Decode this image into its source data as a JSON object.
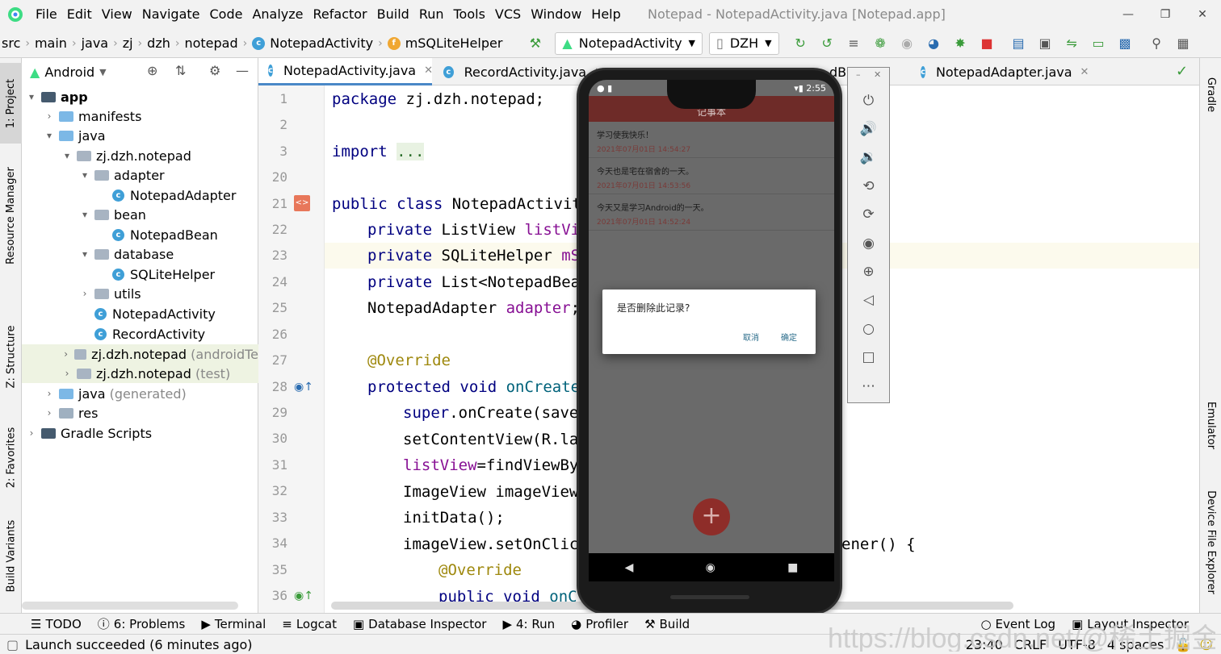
{
  "menubar": {
    "items": [
      "File",
      "Edit",
      "View",
      "Navigate",
      "Code",
      "Analyze",
      "Refactor",
      "Build",
      "Run",
      "Tools",
      "VCS",
      "Window",
      "Help"
    ],
    "window_title": "Notepad - NotepadActivity.java [Notepad.app]"
  },
  "navbar": {
    "breadcrumbs": [
      "src",
      "main",
      "java",
      "zj",
      "dzh",
      "notepad",
      "NotepadActivity",
      "mSQLiteHelper"
    ],
    "run_config": "NotepadActivity",
    "device": "DZH"
  },
  "side_tabs": {
    "project": "1: Project",
    "resource_manager": "Resource Manager",
    "structure": "Z: Structure",
    "favorites": "2: Favorites",
    "build_variants": "Build Variants",
    "gradle": "Gradle",
    "emulator": "Emulator",
    "device_file_explorer": "Device File Explorer"
  },
  "project_panel": {
    "view": "Android",
    "tree": [
      {
        "label": "app",
        "extra": ""
      },
      {
        "label": "manifests",
        "extra": ""
      },
      {
        "label": "java",
        "extra": ""
      },
      {
        "label": "zj.dzh.notepad",
        "extra": ""
      },
      {
        "label": "adapter",
        "extra": ""
      },
      {
        "label": "NotepadAdapter",
        "extra": ""
      },
      {
        "label": "bean",
        "extra": ""
      },
      {
        "label": "NotepadBean",
        "extra": ""
      },
      {
        "label": "database",
        "extra": ""
      },
      {
        "label": "SQLiteHelper",
        "extra": ""
      },
      {
        "label": "utils",
        "extra": ""
      },
      {
        "label": "NotepadActivity",
        "extra": ""
      },
      {
        "label": "RecordActivity",
        "extra": ""
      },
      {
        "label": "zj.dzh.notepad",
        "extra": "(androidTe"
      },
      {
        "label": "zj.dzh.notepad",
        "extra": "(test)"
      },
      {
        "label": "java",
        "extra": "(generated)"
      },
      {
        "label": "res",
        "extra": ""
      },
      {
        "label": "Gradle Scripts",
        "extra": ""
      }
    ]
  },
  "editor": {
    "tabs": [
      "NotepadActivity.java",
      "RecordActivity.java",
      "NotepadAdapter.java"
    ],
    "tab_partial": "dBe",
    "line_numbers": [
      "1",
      "2",
      "3",
      "20",
      "21",
      "22",
      "23",
      "24",
      "25",
      "26",
      "27",
      "28",
      "29",
      "30",
      "31",
      "32",
      "33",
      "34",
      "35",
      "36"
    ],
    "lines": {
      "l1_kw": "package",
      "l1_rest": " zj.dzh.notepad;",
      "l3_kw": "import",
      "l3_fold": "...",
      "l21_kw": "public class",
      "l21_rest": " NotepadActivity",
      "l22_kw": "private",
      "l22_type": " ListView ",
      "l22_field": "listVie",
      "l23_kw": "private",
      "l23_type": " SQLiteHelper ",
      "l23_field": "mSQ",
      "l24_kw": "private",
      "l24_type": " List<NotepadBean",
      "l25_type": "NotepadAdapter ",
      "l25_field": "adapter",
      "l25_end": ";",
      "l27": "@Override",
      "l28_kw": "protected void",
      "l28_m": " onCreate(",
      "l29_kw": "super",
      "l29_rest": ".onCreate(savec",
      "l30": "setContentView(R.lay",
      "l31_f": "listView",
      "l31_rest": "=findViewByI",
      "l32": "ImageView imageView=",
      "l33": "initData();",
      "l34a": "imageView.setOnClick",
      "l34b": "ener() {",
      "l35": "@Override",
      "l36_kw": "public void",
      "l36_m": " onCl"
    }
  },
  "emulator": {
    "time": "2:55",
    "app_title": "记事本",
    "records": [
      {
        "text": "学习使我快乐！",
        "date": "2021年07月01日 14:54:27"
      },
      {
        "text": "今天也是宅在宿舍的一天。",
        "date": "2021年07月01日 14:53:56"
      },
      {
        "text": "今天又是学习Android的一天。",
        "date": "2021年07月01日 14:52:24"
      }
    ],
    "dialog": {
      "message": "是否删除此记录?",
      "cancel": "取消",
      "confirm": "确定"
    },
    "fab": "+",
    "toolbar_icons": [
      "power-icon",
      "volume-up-icon",
      "volume-down-icon",
      "rotate-left-icon",
      "rotate-right-icon",
      "camera-icon",
      "zoom-icon",
      "back-icon",
      "home-icon",
      "overview-icon",
      "more-icon"
    ]
  },
  "bottom_tabs": {
    "todo": "TODO",
    "problems": "6: Problems",
    "terminal": "Terminal",
    "logcat": "Logcat",
    "database_inspector": "Database Inspector",
    "run": "4: Run",
    "profiler": "Profiler",
    "build": "Build",
    "event_log": "Event Log",
    "layout_inspector": "Layout Inspector"
  },
  "status": {
    "message": "Launch succeeded (6 minutes ago)",
    "position": "23:40",
    "line_sep": "CRLF",
    "encoding": "UTF-8",
    "indent": "4 spaces"
  },
  "watermark": "https://blog.csdn.net/@稀土掘金技术社区",
  "colors": {
    "accent": "#4a88c7",
    "app_bar": "#6e2b28",
    "fab": "#8e2d29"
  }
}
